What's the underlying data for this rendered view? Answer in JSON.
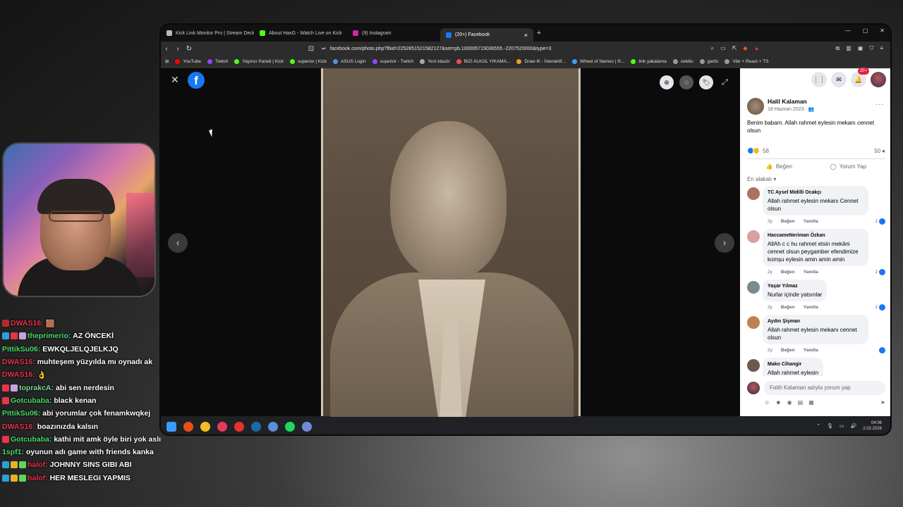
{
  "chat": [
    {
      "badges": [
        "#b22a2a"
      ],
      "name": "DWAS16:",
      "name_color": "#e8354a",
      "message": "🟫"
    },
    {
      "badges": [
        "#2aa0d8",
        "#e8354a",
        "#c9a2e0"
      ],
      "name": "theprimerio:",
      "name_color": "#4bdc6a",
      "message": "AZ ÖNCEKİ"
    },
    {
      "badges": [],
      "name": "PittikSu06:",
      "name_color": "#4bdc6a",
      "message": "EWKQLJELQJELKJQ"
    },
    {
      "badges": [],
      "name": "DWAS16:",
      "name_color": "#e8354a",
      "message": "muhteşem yüzyılda mı oynadı ak"
    },
    {
      "badges": [],
      "name": "DWAS16:",
      "name_color": "#e8354a",
      "message": "👌"
    },
    {
      "badges": [
        "#e8354a",
        "#c9a2e0"
      ],
      "name": "toprakcA:",
      "name_color": "#7cdc9a",
      "message": "abi sen nerdesin"
    },
    {
      "badges": [
        "#e8354a"
      ],
      "name": "Gotcubaba:",
      "name_color": "#4bdc6a",
      "message": "black kenan"
    },
    {
      "badges": [],
      "name": "PittikSu06:",
      "name_color": "#4bdc6a",
      "message": "abi yorumlar çok fenamkwqkej"
    },
    {
      "badges": [],
      "name": "DWAS16:",
      "name_color": "#e8354a",
      "message": "boazınızda kalsın"
    },
    {
      "badges": [
        "#e8354a"
      ],
      "name": "Gotcubaba:",
      "name_color": "#4bdc6a",
      "message": "kathi mit amk öyle biri yok aslında"
    },
    {
      "badges": [],
      "name": "1spf1:",
      "name_color": "#4bdc6a",
      "message": "oyunun adı game with friends kanka"
    },
    {
      "badges": [
        "#2aa0d8",
        "#e8b02a",
        "#5ad85a"
      ],
      "name": "halof:",
      "name_color": "#e8354a",
      "message": "JOHNNY SINS GIBI ABI"
    },
    {
      "badges": [
        "#2aa0d8",
        "#e8b02a",
        "#5ad85a"
      ],
      "name": "halof:",
      "name_color": "#e8354a",
      "message": "HER MESLEGI YAPMIS"
    }
  ],
  "browser": {
    "tabs": [
      {
        "label": "Kick Link Monitor Pro | Stream Deck",
        "icon_color": "#bbbbbb",
        "active": false
      },
      {
        "label": "About HaxG - Watch Live on Kick",
        "icon_color": "#53fc18",
        "active": false
      },
      {
        "label": "(9) Instagram",
        "icon_color": "#d6249f",
        "active": false
      },
      {
        "label": "(20+) Facebook",
        "icon_color": "#1877f2",
        "active": true
      }
    ],
    "new_tab": "+",
    "url": "facebook.com/photo.php?fbid=2252851521582127&set=pb.100005719036555.-2207520000&type=3",
    "bookmarks": [
      {
        "label": "YouTube",
        "color": "#ff0000"
      },
      {
        "label": "Twitch",
        "color": "#9146ff"
      },
      {
        "label": "Yayıncı Paneli | Kick",
        "color": "#53fc18"
      },
      {
        "label": "superior | Kick",
        "color": "#53fc18"
      },
      {
        "label": "ASUS Login",
        "color": "#5a8fd8"
      },
      {
        "label": "superior - Twitch",
        "color": "#9146ff"
      },
      {
        "label": "Yeni klasör",
        "color": "#aaaaaa"
      },
      {
        "label": "BIZI ALKOL YIKAMA...",
        "color": "#ff4a4a"
      },
      {
        "label": "Draw It! - İnteraktif...",
        "color": "#e8a02a"
      },
      {
        "label": "Wheel of Names | R...",
        "color": "#3aa0ff"
      },
      {
        "label": "link yakalama",
        "color": "#53fc18"
      },
      {
        "label": "cekilis",
        "color": "#999999"
      },
      {
        "label": "gartic",
        "color": "#999999"
      },
      {
        "label": "Vite + React + TS",
        "color": "#999999"
      }
    ]
  },
  "viewer": {
    "close": "✕",
    "logo": "f",
    "prev": "‹",
    "next": "›",
    "tools": [
      "⊕",
      "⊖",
      "🏷"
    ],
    "expand": "⤢"
  },
  "post": {
    "notif_count": "20+",
    "author": "Halil Kalaman",
    "date": "18 Haziran 2023 · 👥",
    "more": "···",
    "text": "Benim babam. Allah rahmet eylesin mekanı cennet olsun",
    "reactions_count": "58",
    "comments_count": "50",
    "like_label": "Beğen",
    "comment_label": "Yorum Yap",
    "sort_label": "En alakalı ▾",
    "comments": [
      {
        "name": "TC Aysel Midilli Ocakçı",
        "text": "Allah rahmet eylesin mekanı Cennet olsun",
        "time": "2y",
        "like": "Beğen",
        "reply": "Yanıtla",
        "likes": "2",
        "avatar": "#b07060"
      },
      {
        "name": "HaccameNeriman Özkan",
        "text": "AllAh c c hu rahmet etsin mekâni cennet olsun peygamber efendimize komşu eylesin amin amin amin",
        "time": "2y",
        "like": "Beğen",
        "reply": "Yanıtla",
        "likes": "2",
        "avatar": "#d8a0a0"
      },
      {
        "name": "Yaşar Yılmaz",
        "text": "Nurlar içinde yatsınlar",
        "time": "2y",
        "like": "Beğen",
        "reply": "Yanıtla",
        "likes": "2",
        "avatar": "#7a8a90"
      },
      {
        "name": "Aydın Şişman",
        "text": "Allah rahmet eylesin mekanı cennet olsun",
        "time": "2y",
        "like": "Beğen",
        "reply": "Yanıtla",
        "likes": "",
        "avatar": "#c08050"
      },
      {
        "name": "Mako Cihangir",
        "text": "Allah rahmet eylesin",
        "time": "",
        "like": "",
        "reply": "",
        "likes": "",
        "avatar": "#6a5a50"
      }
    ],
    "composer_placeholder": "Fatih Kalaman adıyla yorum yap"
  },
  "taskbar": {
    "icons": [
      "#3a9bff",
      "#e8501a",
      "#f0c020",
      "#e83a5a",
      "#e83030",
      "#1b6aa5",
      "#5a8fd8",
      "#1ed760",
      "#7289da"
    ],
    "time": "04:06",
    "date": "2.02.2026"
  }
}
